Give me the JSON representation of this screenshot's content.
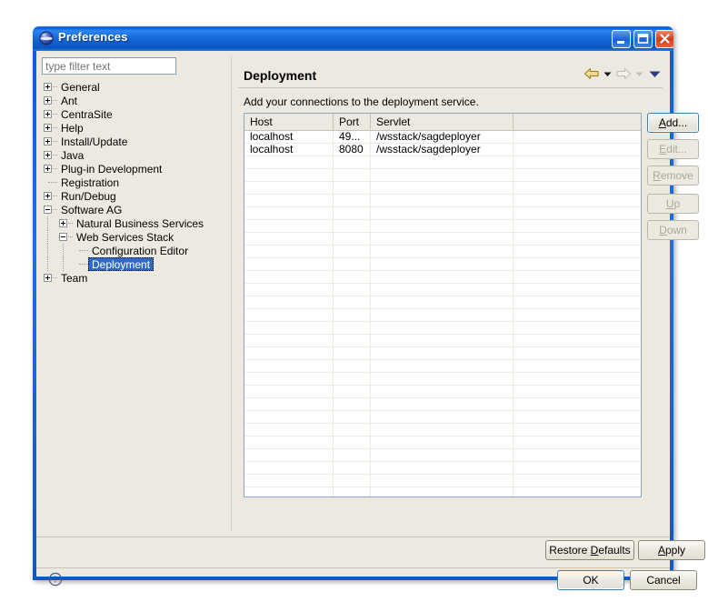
{
  "window": {
    "title": "Preferences",
    "icon": "eclipse-globe-icon",
    "minimize_label": "",
    "maximize_label": "",
    "close_label": ""
  },
  "filter": {
    "value": "",
    "placeholder": "type filter text"
  },
  "tree": {
    "items": [
      {
        "label": "General",
        "level": 0,
        "expander": "plus",
        "selected": false
      },
      {
        "label": "Ant",
        "level": 0,
        "expander": "plus",
        "selected": false
      },
      {
        "label": "CentraSite",
        "level": 0,
        "expander": "plus",
        "selected": false
      },
      {
        "label": "Help",
        "level": 0,
        "expander": "plus",
        "selected": false
      },
      {
        "label": "Install/Update",
        "level": 0,
        "expander": "plus",
        "selected": false
      },
      {
        "label": "Java",
        "level": 0,
        "expander": "plus",
        "selected": false
      },
      {
        "label": "Plug-in Development",
        "level": 0,
        "expander": "plus",
        "selected": false
      },
      {
        "label": "Registration",
        "level": 0,
        "expander": "none",
        "selected": false
      },
      {
        "label": "Run/Debug",
        "level": 0,
        "expander": "plus",
        "selected": false
      },
      {
        "label": "Software AG",
        "level": 0,
        "expander": "minus",
        "selected": false
      },
      {
        "label": "Natural Business Services",
        "level": 1,
        "expander": "plus",
        "selected": false
      },
      {
        "label": "Web Services Stack",
        "level": 1,
        "expander": "minus",
        "selected": false
      },
      {
        "label": "Configuration Editor",
        "level": 2,
        "expander": "none",
        "selected": false
      },
      {
        "label": "Deployment",
        "level": 2,
        "expander": "none",
        "selected": true
      },
      {
        "label": "Team",
        "level": 0,
        "expander": "plus",
        "selected": false
      }
    ]
  },
  "page": {
    "title": "Deployment",
    "description": "Add your connections to the deployment service.",
    "nav": {
      "back_icon": "back-arrow-icon",
      "back_menu_icon": "chevron-down-icon",
      "forward_icon": "forward-arrow-icon",
      "forward_menu_icon": "chevron-down-icon",
      "menu_icon": "chevron-down-icon"
    }
  },
  "table": {
    "columns": [
      "Host",
      "Port",
      "Servlet",
      ""
    ],
    "rows": [
      [
        "localhost",
        "49...",
        "/wsstack/sagdeployer",
        ""
      ],
      [
        "localhost",
        "8080",
        "/wsstack/sagdeployer",
        ""
      ]
    ],
    "empty_row_count": 28
  },
  "side_buttons": [
    {
      "label": "Add...",
      "mnemonic": "A",
      "enabled": true,
      "focused": true
    },
    {
      "label": "Edit...",
      "mnemonic": "E",
      "enabled": false,
      "focused": false
    },
    {
      "label": "Remove",
      "mnemonic": "R",
      "enabled": false,
      "focused": false
    },
    {
      "label": "Up",
      "mnemonic": "U",
      "enabled": false,
      "focused": false
    },
    {
      "label": "Down",
      "mnemonic": "D",
      "enabled": false,
      "focused": false
    }
  ],
  "footer": {
    "restore_defaults": "Restore Defaults",
    "restore_mnemonic": "D",
    "apply": "Apply",
    "apply_mnemonic": "A",
    "help_icon": "help-question-icon",
    "ok": "OK",
    "cancel": "Cancel"
  },
  "colors": {
    "dialog_background": "#ECE9E0",
    "titlebar_blue": "#1567D8",
    "selection_blue": "#316AC5",
    "table_border": "#8CA8C0",
    "back_arrow_gold": "#E8C24A",
    "close_red": "#D63A19"
  }
}
